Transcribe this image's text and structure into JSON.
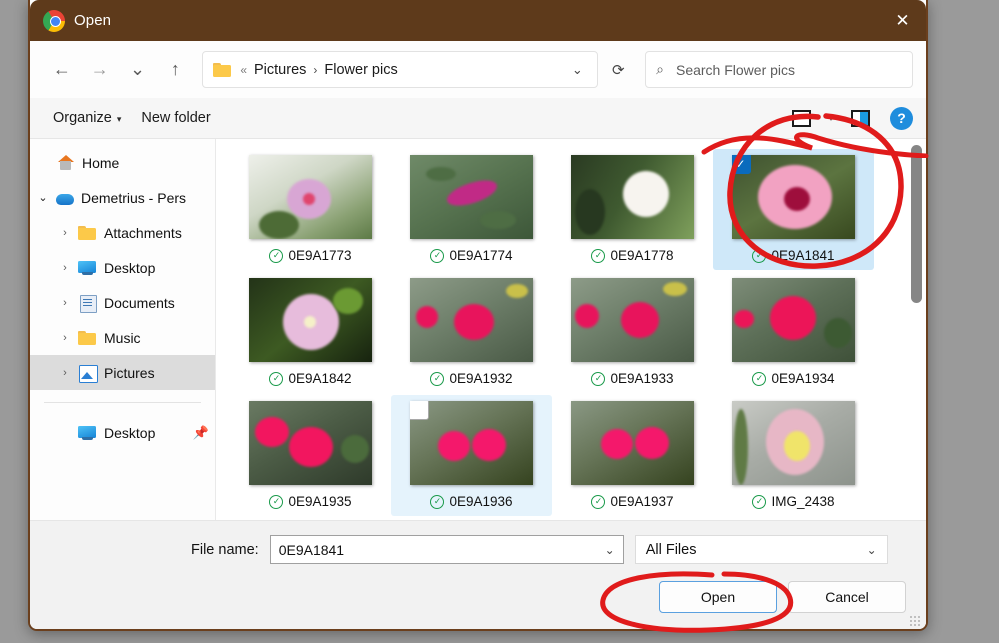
{
  "window": {
    "title": "Open",
    "app_icon": "chrome-logo-icon",
    "close_label": "✕"
  },
  "nav": {
    "back": "←",
    "forward": "→",
    "recent": "⌄",
    "up": "↑",
    "refresh": "⟳",
    "address_chevron": "⌄",
    "breadcrumb": {
      "overflow": "«",
      "items": [
        "Pictures",
        "Flower pics"
      ],
      "separator": "›"
    },
    "search": {
      "icon": "search-icon",
      "placeholder": "Search Flower pics"
    }
  },
  "toolbar": {
    "organize": "Organize",
    "organize_caret": "▾",
    "new_folder": "New folder",
    "view_caret": "▾",
    "help": "?"
  },
  "sidebar": {
    "items": [
      {
        "label": "Home",
        "icon": "home-icon",
        "chevron": "",
        "indent": 1,
        "selected": false
      },
      {
        "label": "Demetrius - Pers",
        "icon": "onedrive-cloud-icon",
        "chevron": "⌄",
        "indent": 0,
        "selected": false
      },
      {
        "label": "Attachments",
        "icon": "folder-icon",
        "chevron": "›",
        "indent": 1,
        "selected": false
      },
      {
        "label": "Desktop",
        "icon": "desktop-icon",
        "chevron": "›",
        "indent": 1,
        "selected": false
      },
      {
        "label": "Documents",
        "icon": "documents-icon",
        "chevron": "›",
        "indent": 1,
        "selected": false
      },
      {
        "label": "Music",
        "icon": "folder-icon",
        "chevron": "›",
        "indent": 1,
        "selected": false
      },
      {
        "label": "Pictures",
        "icon": "pictures-icon",
        "chevron": "›",
        "indent": 1,
        "selected": true
      }
    ],
    "pinned": [
      {
        "label": "Desktop",
        "icon": "desktop-icon",
        "pin": "📌"
      }
    ]
  },
  "files": {
    "sync_badge": "✓",
    "items": [
      {
        "name": "0E9A1773",
        "selected": false,
        "hover": false,
        "checkbox": "none"
      },
      {
        "name": "0E9A1774",
        "selected": false,
        "hover": false,
        "checkbox": "none"
      },
      {
        "name": "0E9A1778",
        "selected": false,
        "hover": false,
        "checkbox": "none"
      },
      {
        "name": "0E9A1841",
        "selected": true,
        "hover": false,
        "checkbox": "checked"
      },
      {
        "name": "0E9A1842",
        "selected": false,
        "hover": false,
        "checkbox": "none"
      },
      {
        "name": "0E9A1932",
        "selected": false,
        "hover": false,
        "checkbox": "none"
      },
      {
        "name": "0E9A1933",
        "selected": false,
        "hover": false,
        "checkbox": "none"
      },
      {
        "name": "0E9A1934",
        "selected": false,
        "hover": false,
        "checkbox": "none"
      },
      {
        "name": "0E9A1935",
        "selected": false,
        "hover": false,
        "checkbox": "none"
      },
      {
        "name": "0E9A1936",
        "selected": false,
        "hover": true,
        "checkbox": "empty"
      },
      {
        "name": "0E9A1937",
        "selected": false,
        "hover": false,
        "checkbox": "none"
      },
      {
        "name": "IMG_2438",
        "selected": false,
        "hover": false,
        "checkbox": "none"
      }
    ]
  },
  "footer": {
    "filename_label": "File name:",
    "filename_value": "0E9A1841",
    "filename_chevron": "⌄",
    "filter_value": "All Files",
    "filter_chevron": "⌄",
    "open_label": "Open",
    "cancel_label": "Cancel"
  },
  "annotations": {
    "color": "#e01b1b",
    "marks": [
      "ellipse-around-selected-thumbnail",
      "ellipse-around-open-button"
    ]
  }
}
